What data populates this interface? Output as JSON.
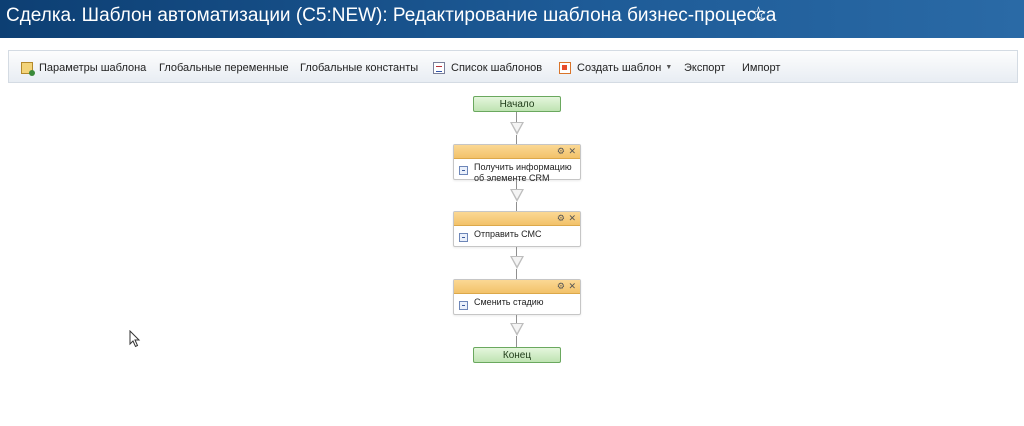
{
  "header": {
    "title": "Сделка. Шаблон автоматизации (C5:NEW): Редактирование шаблона бизнес-процесса",
    "star": "☆"
  },
  "toolbar": {
    "template_params": "Параметры шаблона",
    "global_vars": "Глобальные переменные",
    "global_consts": "Глобальные константы",
    "template_list": "Список шаблонов",
    "create_template": "Создать шаблон",
    "export": "Экспорт",
    "import": "Импорт"
  },
  "flow": {
    "start": "Начало",
    "end": "Конец",
    "blocks": [
      {
        "label": "Получить информацию об элементе CRM"
      },
      {
        "label": "Отправить СМС"
      },
      {
        "label": "Сменить стадию"
      }
    ]
  },
  "icons": {
    "gear": "⚙",
    "close": "✕",
    "caret": "▼"
  }
}
